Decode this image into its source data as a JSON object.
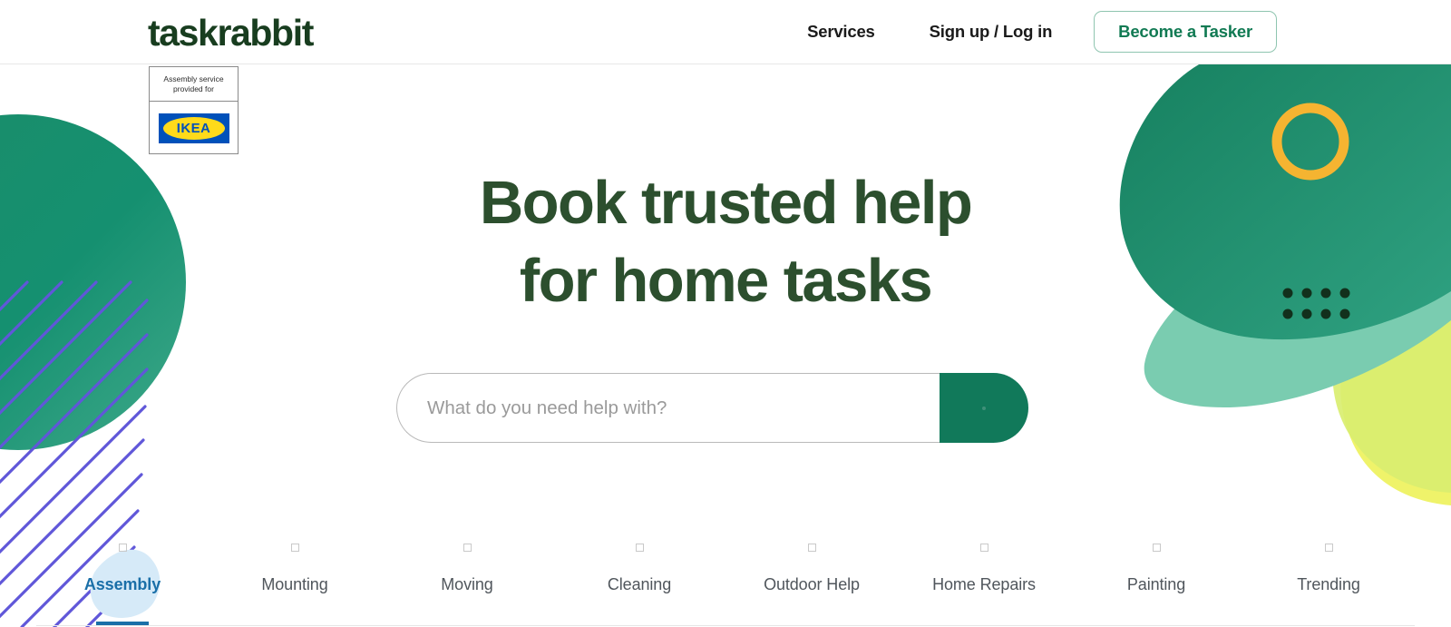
{
  "colors": {
    "brand_dark_green": "#183D1F",
    "headline_green": "#2C4F2E",
    "button_green": "#11795A",
    "outline_green": "#8FC5B0",
    "link_green": "#117A53",
    "active_tab_blue": "#1A6FA8",
    "tab_label_gray": "#50565C",
    "decor_dark_green": "#16805F",
    "decor_teal": "#7ACCB0",
    "decor_lime": "#D9EE70",
    "decor_yellow": "#EFF36A",
    "decor_yellow_ring": "#F5B431",
    "decor_purple": "#6057D9",
    "decor_lightblue": "#D6EAF8",
    "ikea_blue": "#0051BA",
    "ikea_yellow": "#FFDA1A"
  },
  "header": {
    "logo": "taskrabbit",
    "nav": [
      {
        "label": "Services",
        "name": "nav-services"
      },
      {
        "label": "Sign up / Log in",
        "name": "nav-signup-login"
      }
    ],
    "cta_label": "Become a Tasker"
  },
  "ikea_badge": {
    "caption": "Assembly service provided for",
    "brand": "IKEA"
  },
  "hero": {
    "headline_line1": "Book trusted help",
    "headline_line2": "for home tasks"
  },
  "search": {
    "placeholder": "What do you need help with?",
    "value": "",
    "button_icon": "search-icon"
  },
  "categories": {
    "active_index": 0,
    "items": [
      {
        "label": "Assembly",
        "icon": "assembly-icon"
      },
      {
        "label": "Mounting",
        "icon": "mounting-icon"
      },
      {
        "label": "Moving",
        "icon": "moving-icon"
      },
      {
        "label": "Cleaning",
        "icon": "cleaning-icon"
      },
      {
        "label": "Outdoor Help",
        "icon": "outdoor-help-icon"
      },
      {
        "label": "Home Repairs",
        "icon": "home-repairs-icon"
      },
      {
        "label": "Painting",
        "icon": "painting-icon"
      },
      {
        "label": "Trending",
        "icon": "trending-icon"
      }
    ]
  }
}
